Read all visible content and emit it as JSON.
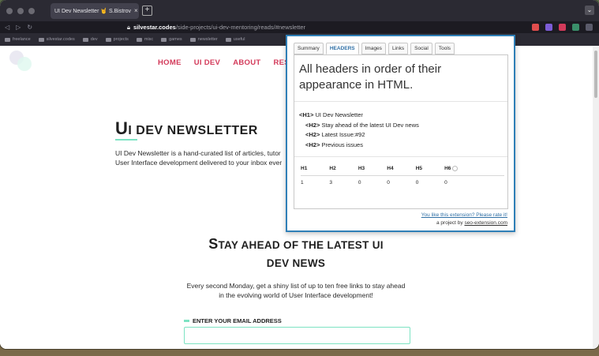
{
  "browser": {
    "tab_title": "UI Dev Newsletter 🤘 S.Bistrov",
    "tab_close": "×",
    "new_tab": "+",
    "url_host": "silvestar.codes",
    "url_path": "/side-projects/ui-dev-mentoring/reads/#newsletter"
  },
  "bookmarks": [
    {
      "label": "freelance"
    },
    {
      "label": "silvestar.codes"
    },
    {
      "label": "dev"
    },
    {
      "label": "projects"
    },
    {
      "label": "misc"
    },
    {
      "label": "games"
    },
    {
      "label": "newsletter"
    },
    {
      "label": "useful"
    }
  ],
  "site": {
    "nav": [
      "HOME",
      "UI DEV",
      "ABOUT",
      "RESO"
    ],
    "h1_first": "U",
    "h1_rest": "I DEV NEWSLETTER",
    "intro_line1": "UI Dev Newsletter is a hand-curated list of articles, tutor",
    "intro_line2": "User Interface development delivered to your inbox ever",
    "h2_s": "S",
    "h2_rest1": "TAY AHEAD OF THE LATEST UI",
    "h2_line2": "DEV NEWS",
    "sub_line1": "Every second Monday, get a shiny list of up to ten free links to stay ahead",
    "sub_line2": "in the evolving world of User Interface development!",
    "email_label": "ENTER YOUR EMAIL ADDRESS"
  },
  "popup": {
    "tabs": [
      "Summary",
      "HEADERS",
      "Images",
      "Links",
      "Social",
      "Tools"
    ],
    "active_tab": "HEADERS",
    "title": "All headers in order of their appearance in HTML.",
    "headers": [
      {
        "tag": "<H1>",
        "text": "UI Dev Newsletter"
      },
      {
        "tag": "<H2>",
        "text": "Stay ahead of the latest UI Dev news"
      },
      {
        "tag": "<H2>",
        "text": "Latest Issue:#92"
      },
      {
        "tag": "<H2>",
        "text": "Previous issues"
      }
    ],
    "table_headers": [
      "H1",
      "H2",
      "H3",
      "H4",
      "H5",
      "H6"
    ],
    "table_counts": [
      "1",
      "3",
      "0",
      "0",
      "0",
      "0"
    ],
    "rate_link": "You like this extension? Please rate it!",
    "project_prefix": "a project by ",
    "project_link": "seo-extension.com"
  }
}
